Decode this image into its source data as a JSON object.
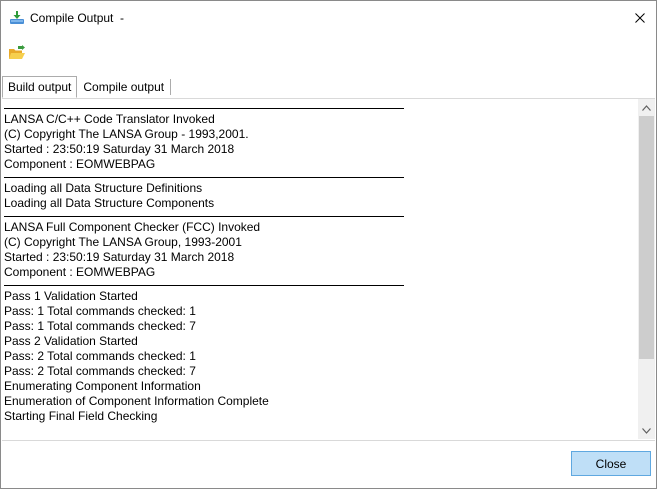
{
  "window": {
    "title": "Compile Output  -"
  },
  "tabs": [
    {
      "label": "Build output",
      "active": true
    },
    {
      "label": "Compile output",
      "active": false
    }
  ],
  "output": {
    "blocks": [
      {
        "lines": [
          "LANSA C/C++ Code Translator Invoked",
          "(C) Copyright The LANSA Group - 1993,2001.",
          "Started : 23:50:19 Saturday 31 March 2018",
          "Component : EOMWEBPAG"
        ]
      },
      {
        "lines": [
          "Loading all Data Structure Definitions",
          "Loading all Data Structure Components"
        ]
      },
      {
        "lines": [
          "LANSA Full Component Checker (FCC) Invoked",
          "(C) Copyright The LANSA Group, 1993-2001",
          "Started : 23:50:19 Saturday 31 March 2018",
          "Component : EOMWEBPAG"
        ]
      },
      {
        "lines": [
          "Pass 1 Validation Started",
          "Pass: 1 Total commands checked: 1",
          "Pass: 1 Total commands checked: 7",
          "Pass 2 Validation Started",
          "Pass: 2 Total commands checked: 1",
          "Pass: 2 Total commands checked: 7",
          "Enumerating Component Information",
          "Enumeration of Component Information Complete",
          "Starting Final Field Checking"
        ]
      }
    ]
  },
  "footer": {
    "close_label": "Close"
  },
  "icons": {
    "app": "download-icon",
    "toolbar_open": "open-folder-icon",
    "window_close": "close-icon"
  },
  "colors": {
    "close_button_bg": "#bfdff7",
    "close_button_border": "#5fa8e0",
    "folder": "#f2c037"
  }
}
